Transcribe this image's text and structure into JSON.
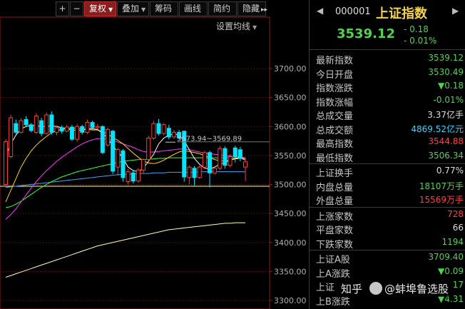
{
  "toolbar": {
    "buttons": [
      {
        "label": "+",
        "square": true
      },
      {
        "label": "−",
        "square": true
      },
      {
        "label": "复权",
        "active": true,
        "caret": true
      },
      {
        "label": "叠加",
        "caret": true
      },
      {
        "label": "筹码"
      },
      {
        "label": "画线"
      },
      {
        "label": "简约"
      },
      {
        "label": "隐藏",
        "chevron": "▸▸"
      }
    ]
  },
  "chart": {
    "ma_setting_label": "设置均线",
    "range_annotation": "3573.94~3569.89",
    "y_ticks": [
      "3700.00",
      "3650.00",
      "3600.00",
      "3550.00",
      "3500.00",
      "3450.00",
      "3400.00",
      "3350.00",
      "3300.00"
    ],
    "colors": {
      "up": "#ff3b3b",
      "down": "#00e5ff",
      "ma5": "#ffffff",
      "ma10": "#ffd700",
      "ma20": "#ff33ff",
      "ma30": "#33ff33",
      "ma60": "#33a8ff",
      "ma120": "#ffffaa",
      "grid": "#6b1a1a",
      "axis": "#8b1a1a"
    }
  },
  "chart_data": {
    "type": "candlestick",
    "title": "",
    "ylim": [
      3300,
      3720
    ],
    "reference_line": 3497,
    "candles": [
      {
        "o": 3500,
        "c": 3574,
        "h": 3578,
        "l": 3496
      },
      {
        "o": 3548,
        "c": 3615,
        "h": 3620,
        "l": 3545
      },
      {
        "o": 3605,
        "c": 3590,
        "h": 3612,
        "l": 3587
      },
      {
        "o": 3590,
        "c": 3610,
        "h": 3614,
        "l": 3588
      },
      {
        "o": 3612,
        "c": 3603,
        "h": 3618,
        "l": 3600
      },
      {
        "o": 3603,
        "c": 3593,
        "h": 3606,
        "l": 3590
      },
      {
        "o": 3590,
        "c": 3618,
        "h": 3623,
        "l": 3587
      },
      {
        "o": 3610,
        "c": 3588,
        "h": 3615,
        "l": 3583
      },
      {
        "o": 3588,
        "c": 3620,
        "h": 3624,
        "l": 3586
      },
      {
        "o": 3620,
        "c": 3590,
        "h": 3626,
        "l": 3586
      },
      {
        "o": 3590,
        "c": 3598,
        "h": 3602,
        "l": 3585
      },
      {
        "o": 3598,
        "c": 3592,
        "h": 3602,
        "l": 3588
      },
      {
        "o": 3592,
        "c": 3599,
        "h": 3603,
        "l": 3590
      },
      {
        "o": 3599,
        "c": 3578,
        "h": 3603,
        "l": 3575
      },
      {
        "o": 3578,
        "c": 3600,
        "h": 3604,
        "l": 3574
      },
      {
        "o": 3600,
        "c": 3590,
        "h": 3603,
        "l": 3586
      },
      {
        "o": 3590,
        "c": 3607,
        "h": 3612,
        "l": 3587
      },
      {
        "o": 3607,
        "c": 3598,
        "h": 3610,
        "l": 3594
      },
      {
        "o": 3598,
        "c": 3600,
        "h": 3604,
        "l": 3595
      },
      {
        "o": 3600,
        "c": 3555,
        "h": 3602,
        "l": 3552
      },
      {
        "o": 3568,
        "c": 3595,
        "h": 3598,
        "l": 3565
      },
      {
        "o": 3592,
        "c": 3523,
        "h": 3594,
        "l": 3518
      },
      {
        "o": 3530,
        "c": 3560,
        "h": 3563,
        "l": 3515
      },
      {
        "o": 3558,
        "c": 3512,
        "h": 3561,
        "l": 3505
      },
      {
        "o": 3505,
        "c": 3522,
        "h": 3527,
        "l": 3500
      },
      {
        "o": 3520,
        "c": 3506,
        "h": 3524,
        "l": 3502
      },
      {
        "o": 3506,
        "c": 3525,
        "h": 3528,
        "l": 3503
      },
      {
        "o": 3525,
        "c": 3543,
        "h": 3545,
        "l": 3520
      },
      {
        "o": 3543,
        "c": 3580,
        "h": 3584,
        "l": 3540
      },
      {
        "o": 3580,
        "c": 3605,
        "h": 3610,
        "l": 3577
      },
      {
        "o": 3605,
        "c": 3588,
        "h": 3613,
        "l": 3585
      },
      {
        "o": 3588,
        "c": 3603,
        "h": 3606,
        "l": 3585
      },
      {
        "o": 3597,
        "c": 3582,
        "h": 3603,
        "l": 3578
      },
      {
        "o": 3582,
        "c": 3590,
        "h": 3594,
        "l": 3579
      },
      {
        "o": 3590,
        "c": 3580,
        "h": 3594,
        "l": 3577
      },
      {
        "o": 3592,
        "c": 3513,
        "h": 3574,
        "l": 3505
      },
      {
        "o": 3512,
        "c": 3530,
        "h": 3533,
        "l": 3500
      },
      {
        "o": 3528,
        "c": 3512,
        "h": 3532,
        "l": 3498
      },
      {
        "o": 3512,
        "c": 3530,
        "h": 3533,
        "l": 3510
      },
      {
        "o": 3530,
        "c": 3555,
        "h": 3558,
        "l": 3527
      },
      {
        "o": 3555,
        "c": 3520,
        "h": 3558,
        "l": 3495
      },
      {
        "o": 3520,
        "c": 3528,
        "h": 3532,
        "l": 3517
      },
      {
        "o": 3528,
        "c": 3562,
        "h": 3566,
        "l": 3525
      },
      {
        "o": 3562,
        "c": 3533,
        "h": 3566,
        "l": 3527
      },
      {
        "o": 3533,
        "c": 3548,
        "h": 3552,
        "l": 3530
      },
      {
        "o": 3563,
        "c": 3548,
        "h": 3567,
        "l": 3538
      },
      {
        "o": 3560,
        "c": 3545,
        "h": 3565,
        "l": 3540
      },
      {
        "o": 3530,
        "c": 3539,
        "h": 3545,
        "l": 3506
      }
    ],
    "ma5": [
      3550,
      3570,
      3585,
      3596,
      3600,
      3602,
      3601,
      3600,
      3600,
      3601,
      3600,
      3598,
      3596,
      3594,
      3593,
      3594,
      3596,
      3596,
      3595,
      3588,
      3580,
      3566,
      3557,
      3545,
      3530,
      3524,
      3522,
      3528,
      3540,
      3552,
      3570,
      3580,
      3585,
      3587,
      3585,
      3575,
      3560,
      3545,
      3535,
      3528,
      3527,
      3530,
      3535,
      3538,
      3542,
      3545,
      3546,
      3542
    ],
    "ma10": [
      3470,
      3490,
      3510,
      3530,
      3545,
      3558,
      3568,
      3576,
      3583,
      3589,
      3593,
      3595,
      3596,
      3597,
      3597,
      3596,
      3595,
      3594,
      3594,
      3591,
      3587,
      3581,
      3576,
      3570,
      3562,
      3554,
      3547,
      3541,
      3537,
      3536,
      3538,
      3542,
      3547,
      3552,
      3556,
      3558,
      3557,
      3555,
      3553,
      3550,
      3546,
      3543,
      3541,
      3541,
      3542,
      3544,
      3545,
      3545
    ],
    "ma20": [
      3440,
      3448,
      3458,
      3470,
      3482,
      3494,
      3505,
      3515,
      3524,
      3532,
      3540,
      3547,
      3553,
      3559,
      3565,
      3570,
      3574,
      3577,
      3579,
      3579,
      3578,
      3576,
      3573,
      3570,
      3567,
      3564,
      3560,
      3557,
      3556,
      3556,
      3557,
      3558,
      3559,
      3560,
      3561,
      3561,
      3560,
      3558,
      3556,
      3554,
      3553,
      3552,
      3551,
      3550,
      3549,
      3548,
      3547,
      3546
    ],
    "ma30": [
      3460,
      3462,
      3466,
      3471,
      3477,
      3483,
      3489,
      3495,
      3500,
      3505,
      3509,
      3513,
      3516,
      3519,
      3522,
      3524,
      3526,
      3528,
      3530,
      3532,
      3534,
      3536,
      3538,
      3540,
      3541,
      3542,
      3543,
      3543,
      3544,
      3544,
      3545,
      3545,
      3546,
      3546,
      3546,
      3546,
      3546,
      3546,
      3546,
      3546,
      3546,
      3546,
      3546,
      3546,
      3546,
      3546,
      3546,
      3546
    ],
    "ma60": [
      3495,
      3496,
      3497,
      3498,
      3499,
      3500,
      3501,
      3502,
      3503,
      3504,
      3505,
      3506,
      3507,
      3508,
      3509,
      3510,
      3511,
      3512,
      3513,
      3514,
      3515,
      3516,
      3517,
      3517,
      3518,
      3518,
      3519,
      3519,
      3519,
      3520,
      3520,
      3520,
      3521,
      3521,
      3521,
      3521,
      3521,
      3521,
      3522,
      3522,
      3522,
      3522,
      3522,
      3522,
      3522,
      3522,
      3522,
      3522
    ],
    "ma120": [
      3340,
      3343,
      3346,
      3349,
      3352,
      3355,
      3358,
      3361,
      3364,
      3367,
      3370,
      3373,
      3376,
      3379,
      3382,
      3385,
      3388,
      3391,
      3394,
      3396,
      3398,
      3400,
      3402,
      3404,
      3406,
      3408,
      3410,
      3412,
      3414,
      3416,
      3418,
      3420,
      3422,
      3423,
      3424,
      3425,
      3426,
      3427,
      3428,
      3429,
      3430,
      3431,
      3432,
      3433,
      3433,
      3434,
      3434,
      3434
    ]
  },
  "panel": {
    "nav_left": "◀",
    "nav_right": "▶",
    "code": "000001",
    "name": "上证指数",
    "price": "3539.12",
    "change": "- 0.18",
    "change_pct": "- 0.01%",
    "rows": [
      {
        "label": "最新指数",
        "value": "3539.12",
        "color": "#52d152"
      },
      {
        "label": "今日开盘",
        "value": "3530.49",
        "color": "#52d152"
      },
      {
        "label": "指数涨跌",
        "value": "▼0.18",
        "color": "#52d152"
      },
      {
        "label": "指数涨幅",
        "value": "-0.01%",
        "color": "#52d152"
      },
      {
        "label": "总成交量",
        "value": "3.37亿手",
        "color": "#dcdcdc"
      },
      {
        "label": "总成交额",
        "value": "4869.52亿元",
        "color": "#2fd6ff"
      },
      {
        "label": "最高指数",
        "value": "3544.88",
        "color": "#ff4040"
      },
      {
        "label": "最低指数",
        "value": "3506.34",
        "color": "#52d152"
      },
      {
        "label": "上证换手",
        "value": "0.77%",
        "color": "#dcdcdc"
      },
      {
        "label": "内盘总量",
        "value": "18107万手",
        "color": "#52d152"
      },
      {
        "label": "外盘总量",
        "value": "15569万手",
        "color": "#ff4040"
      },
      {
        "label": "上涨家数",
        "value": "728",
        "color": "#ff4040"
      },
      {
        "label": "平盘家数",
        "value": "66",
        "color": "#dcdcdc"
      },
      {
        "label": "下跌家数",
        "value": "1194",
        "color": "#52d152"
      },
      {
        "label": "上证A股",
        "value": "3709.40",
        "color": "#52d152"
      },
      {
        "label": "上A涨跌",
        "value": "▼0.09",
        "color": "#52d152"
      },
      {
        "label": "上证",
        "value": "17",
        "color": "#52d152"
      },
      {
        "label": "上B涨跌",
        "value": "▼4.31",
        "color": "#52d152"
      }
    ]
  },
  "watermark": {
    "left": "知乎",
    "right": "@蚌埠鲁选股"
  }
}
